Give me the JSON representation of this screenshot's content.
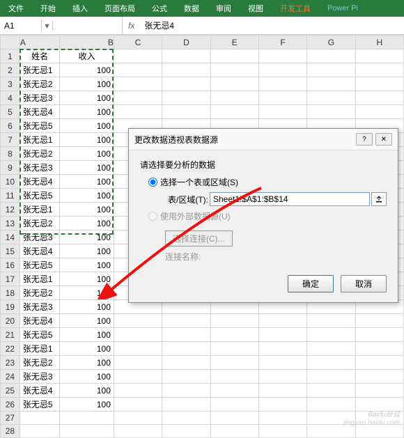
{
  "ribbon": {
    "tabs": [
      "文件",
      "开始",
      "插入",
      "页面布局",
      "公式",
      "数据",
      "审阅",
      "视图",
      "开发工具",
      "Power Pi"
    ]
  },
  "formula_bar": {
    "name_box": "A1",
    "fx": "fx",
    "value": "张无忌4"
  },
  "columns": [
    "A",
    "B",
    "C",
    "D",
    "E",
    "F",
    "G",
    "H"
  ],
  "header_row": {
    "a": "姓名",
    "b": "收入"
  },
  "rows": [
    {
      "n": 1,
      "a": "姓名",
      "b": "收入"
    },
    {
      "n": 2,
      "a": "张无忌1",
      "b": "100"
    },
    {
      "n": 3,
      "a": "张无忌2",
      "b": "100"
    },
    {
      "n": 4,
      "a": "张无忌3",
      "b": "100"
    },
    {
      "n": 5,
      "a": "张无忌4",
      "b": "100"
    },
    {
      "n": 6,
      "a": "张无忌5",
      "b": "100"
    },
    {
      "n": 7,
      "a": "张无忌1",
      "b": "100"
    },
    {
      "n": 8,
      "a": "张无忌2",
      "b": "100"
    },
    {
      "n": 9,
      "a": "张无忌3",
      "b": "100"
    },
    {
      "n": 10,
      "a": "张无忌4",
      "b": "100"
    },
    {
      "n": 11,
      "a": "张无忌5",
      "b": "100"
    },
    {
      "n": 12,
      "a": "张无忌1",
      "b": "100"
    },
    {
      "n": 13,
      "a": "张无忌2",
      "b": "100"
    },
    {
      "n": 14,
      "a": "张无忌3",
      "b": "100"
    },
    {
      "n": 15,
      "a": "张无忌4",
      "b": "100"
    },
    {
      "n": 16,
      "a": "张无忌5",
      "b": "100"
    },
    {
      "n": 17,
      "a": "张无忌1",
      "b": "100"
    },
    {
      "n": 18,
      "a": "张无忌2",
      "b": "100"
    },
    {
      "n": 19,
      "a": "张无忌3",
      "b": "100"
    },
    {
      "n": 20,
      "a": "张无忌4",
      "b": "100"
    },
    {
      "n": 21,
      "a": "张无忌5",
      "b": "100"
    },
    {
      "n": 22,
      "a": "张无忌1",
      "b": "100"
    },
    {
      "n": 23,
      "a": "张无忌2",
      "b": "100"
    },
    {
      "n": 24,
      "a": "张无忌3",
      "b": "100"
    },
    {
      "n": 25,
      "a": "张无忌4",
      "b": "100"
    },
    {
      "n": 26,
      "a": "张无忌5",
      "b": "100"
    },
    {
      "n": 27,
      "a": "",
      "b": ""
    },
    {
      "n": 28,
      "a": "",
      "b": ""
    }
  ],
  "dialog": {
    "title": "更改数据透视表数据源",
    "section": "请选择要分析的数据",
    "opt1": "选择一个表或区域(S)",
    "range_label": "表/区域(T):",
    "range_value": "Sheet1!$A$1:$B$14",
    "opt2": "使用外部数据源(U)",
    "choose_conn": "选择连接(C)...",
    "conn_name": "连接名称:",
    "ok": "确定",
    "cancel": "取消"
  },
  "watermark": {
    "line1": "Baidu经验",
    "line2": "jingyan.baidu.com"
  }
}
